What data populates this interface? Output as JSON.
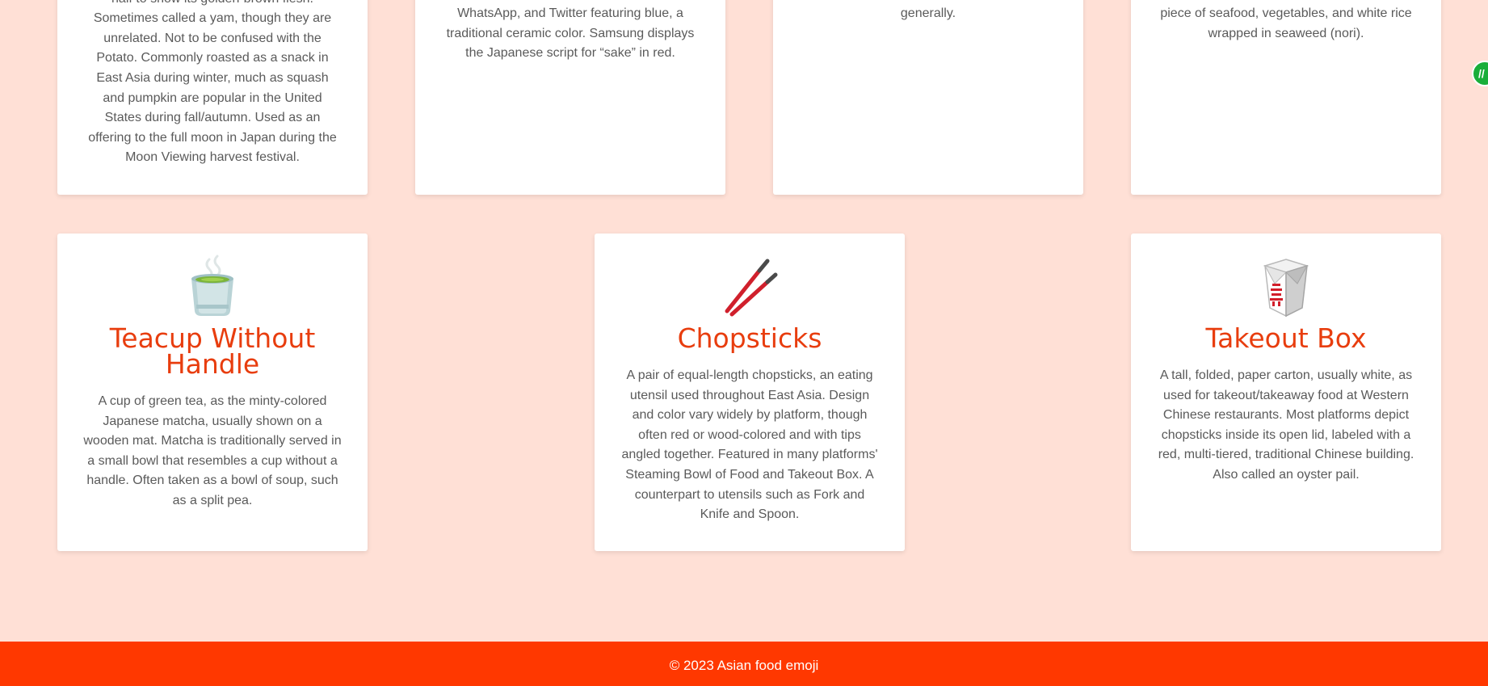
{
  "colors": {
    "background": "#ffe0d6",
    "card": "#ffffff",
    "title": "#e83d0e",
    "footer": "#ff3800"
  },
  "cards": [
    {
      "desc": "half to show its golden-brown flesh. Sometimes called a yam, though they are unrelated. Not to be confused with the Potato. Commonly roasted as a snack in East Asia during winter, much as squash and pumpkin are popular in the United States during fall/autumn. Used as an offering to the full moon in Japan during the Moon Viewing harvest festival."
    },
    {
      "desc": "WhatsApp, and Twitter featuring blue, a traditional ceramic color. Samsung displays the Japanese script for “sake” in red."
    },
    {
      "desc": "generally."
    },
    {
      "desc": "piece of seafood, vegetables, and white rice wrapped in seaweed (nori)."
    },
    {
      "icon": "teacup-icon",
      "title": "Teacup Without Handle",
      "desc": "A cup of green tea, as the minty-colored Japanese matcha, usually shown on a wooden mat. Matcha is traditionally served in a small bowl that resembles a cup without a handle. Often taken as a bowl of soup, such as a split pea."
    },
    {
      "icon": "chopsticks-icon",
      "title": "Chopsticks",
      "desc": "A pair of equal-length chopsticks, an eating utensil used throughout East Asia. Design and color vary widely by platform, though often red or wood-colored and with tips angled together. Featured in many platforms' Steaming Bowl of Food and Takeout Box. A counterpart to utensils such as Fork and Knife and Spoon."
    },
    {
      "icon": "takeout-box-icon",
      "title": "Takeout Box",
      "desc": "A tall, folded, paper carton, usually white, as used for takeout/takeaway food at Western Chinese restaurants. Most platforms depict chopsticks inside its open lid, labeled with a red, multi-tiered, traditional Chinese building. Also called an oyster pail."
    }
  ],
  "footer": {
    "text": "© 2023 Asian food emoji"
  },
  "extension": {
    "icon": "grammarly-icon"
  }
}
